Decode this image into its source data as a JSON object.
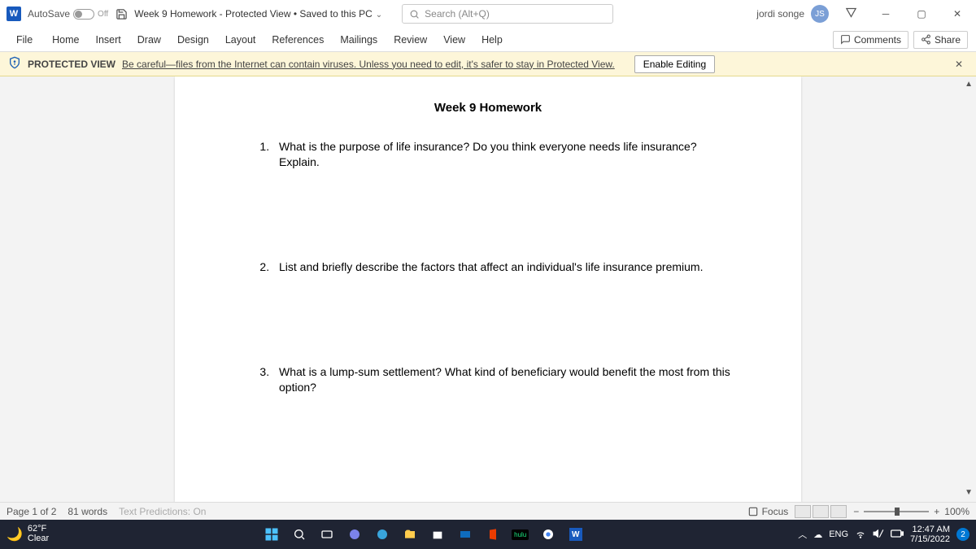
{
  "titlebar": {
    "autosave_label": "AutoSave",
    "autosave_state": "Off",
    "doc_title": "Week 9 Homework  -  Protected View • Saved to this PC",
    "search_placeholder": "Search (Alt+Q)",
    "user_name": "jordi songe",
    "user_initials": "JS"
  },
  "ribbon": {
    "tabs": [
      "File",
      "Home",
      "Insert",
      "Draw",
      "Design",
      "Layout",
      "References",
      "Mailings",
      "Review",
      "View",
      "Help"
    ],
    "comments_label": "Comments",
    "share_label": "Share"
  },
  "protected_view": {
    "label": "PROTECTED VIEW",
    "message": "Be careful—files from the Internet can contain viruses. Unless you need to edit, it's safer to stay in Protected View.",
    "enable_label": "Enable Editing"
  },
  "document": {
    "heading": "Week 9 Homework",
    "questions": [
      "What is the purpose of life insurance? Do you think everyone needs life insurance? Explain.",
      "List and briefly describe the factors that affect an individual's life insurance premium.",
      "What is a lump-sum settlement? What kind of beneficiary would benefit the most from this option?"
    ]
  },
  "statusbar": {
    "page": "Page 1 of 2",
    "words": "81 words",
    "predictions": "Text Predictions: On",
    "focus": "Focus",
    "zoom": "100%"
  },
  "taskbar": {
    "temp": "62°F",
    "cond": "Clear",
    "lang": "ENG",
    "time": "12:47 AM",
    "date": "7/15/2022",
    "notif": "2"
  }
}
